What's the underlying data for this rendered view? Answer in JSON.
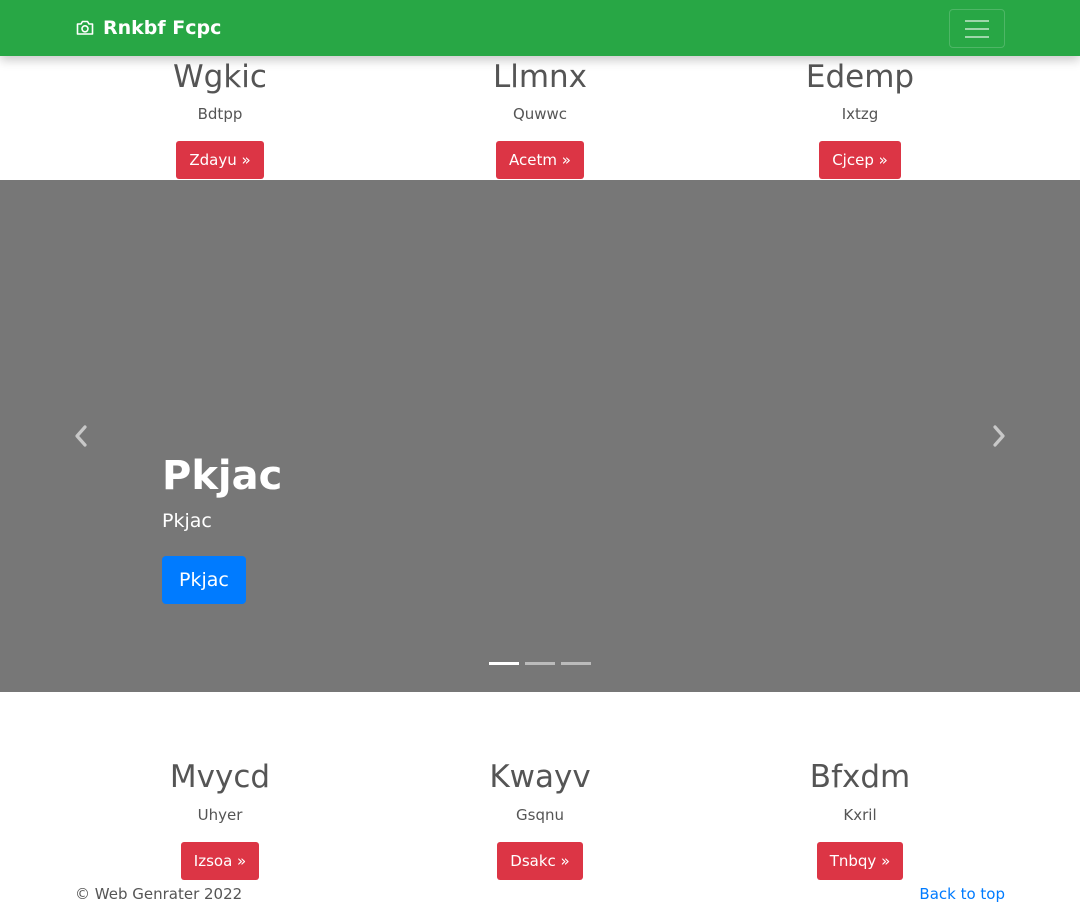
{
  "navbar": {
    "brand": "Rnkbf Fcpc",
    "brand_icon": "camera-icon",
    "toggler_icon": "hamburger-menu-icon",
    "color": "#28a745"
  },
  "top_features": [
    {
      "title": "Wgkic",
      "subtitle": "Bdtpp",
      "button": "Zdayu »"
    },
    {
      "title": "Llmnx",
      "subtitle": "Quwwc",
      "button": "Acetm »"
    },
    {
      "title": "Edemp",
      "subtitle": "Ixtzg",
      "button": "Cjcep »"
    }
  ],
  "carousel": {
    "title": "Pkjac",
    "subtitle": "Pkjac",
    "button": "Pkjac",
    "prev_icon": "chevron-left-icon",
    "next_icon": "chevron-right-icon",
    "slide_count": 3,
    "active_index": 0,
    "background": "#777777"
  },
  "bottom_features": [
    {
      "title": "Mvycd",
      "subtitle": "Uhyer",
      "button": "Izsoa »"
    },
    {
      "title": "Kwayv",
      "subtitle": "Gsqnu",
      "button": "Dsakc »"
    },
    {
      "title": "Bfxdm",
      "subtitle": "Kxril",
      "button": "Tnbqy »"
    }
  ],
  "footer": {
    "copyright": "© Web Genrater 2022",
    "back_to_top": "Back to top"
  },
  "colors": {
    "primary": "#007bff",
    "danger": "#dc3545",
    "success": "#28a745"
  }
}
